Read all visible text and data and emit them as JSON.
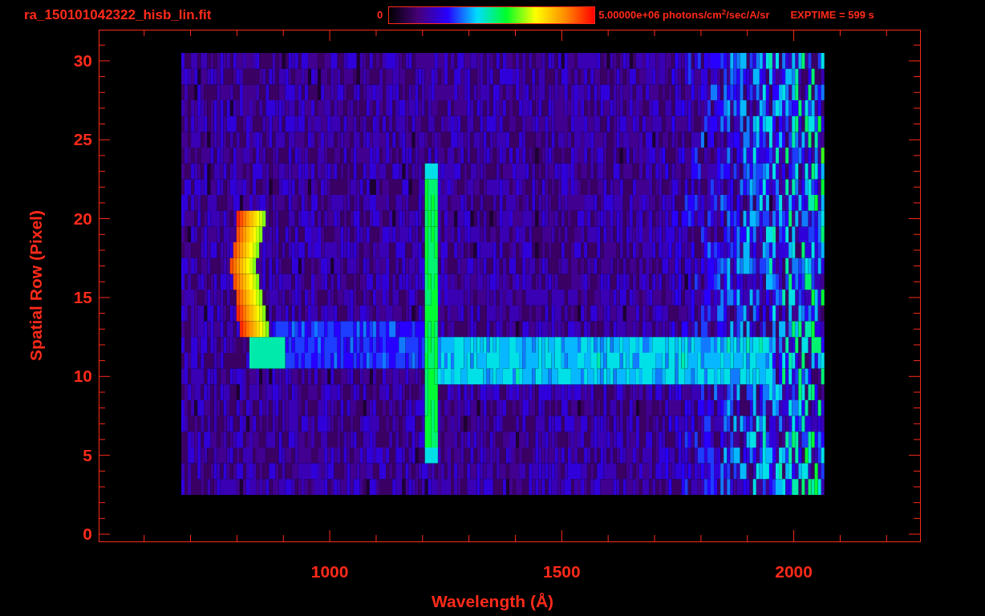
{
  "title": "ra_150101042322_hisb_lin.fit",
  "colorbar": {
    "min_label": "0",
    "max_label": "5.00000e+06 photons/cm$^{2}$/sec/A/sr"
  },
  "exposure": "EXPTIME = 599 s",
  "y_axis": {
    "label": "Spatial Row (Pixel)",
    "ticks": [
      "30",
      "25",
      "20",
      "15",
      "10",
      "5",
      "0"
    ]
  },
  "x_axis": {
    "label": "Wavelength (Å)",
    "ticks": [
      "1000",
      "1500",
      "2000"
    ]
  }
}
